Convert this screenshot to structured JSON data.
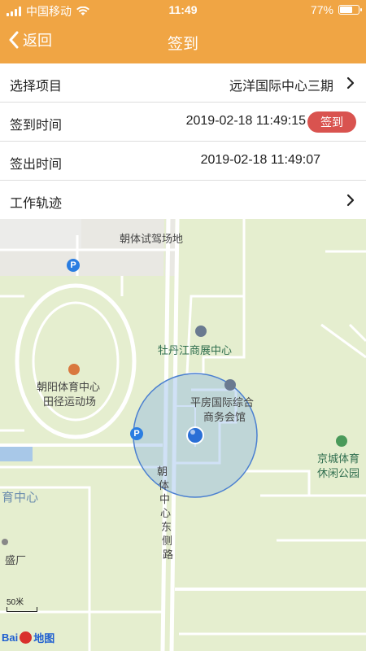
{
  "status_bar": {
    "carrier": "中国移动",
    "time": "11:49",
    "battery_percent": 77,
    "battery_text": "77%"
  },
  "nav": {
    "back_label": "返回",
    "title": "签到"
  },
  "rows": {
    "project": {
      "label": "选择项目",
      "value": "远洋国际中心三期"
    },
    "signin": {
      "label": "签到时间",
      "value": "2019-02-18 11:49:15",
      "button_label": "签到"
    },
    "signout": {
      "label": "签出时间",
      "value": "2019-02-18 11:49:07"
    },
    "track": {
      "label": "工作轨迹"
    }
  },
  "map": {
    "labels": {
      "driving_range": "朝体试驾场地",
      "stadium_line1": "朝阳体育中心",
      "stadium_line2": "田径运动场",
      "mudanjiang": "牡丹江商展中心",
      "pingfang_line1": "平房国际综合",
      "pingfang_line2": "商务会馆",
      "jingcheng_line1": "京城体育",
      "jingcheng_line2": "休闲公园",
      "road_chars": [
        "朝",
        "体",
        "中",
        "心",
        "东",
        "侧",
        "路"
      ],
      "sports_center_partial": "育中心",
      "shengchang_partial": "盛厂"
    },
    "scale_label": "50米",
    "logo_text": "Bai",
    "logo_suffix": "地图",
    "parking_label": "P"
  },
  "colors": {
    "header": "#f0a544",
    "signin_button": "#d9534f",
    "map_bg": "#e5eecf",
    "location_dot": "#2a6fd6"
  }
}
